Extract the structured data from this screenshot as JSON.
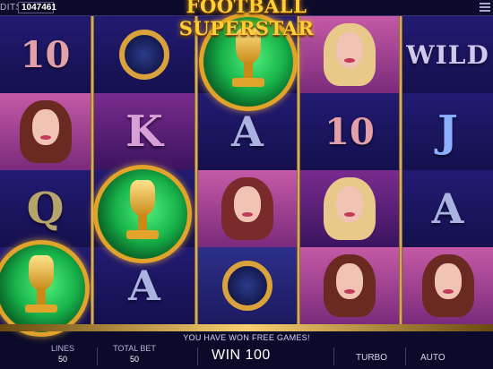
{
  "header": {
    "credits_label": "DITS",
    "credits_value": "1047461",
    "logo": "FOOTBALL SUPERSTAR"
  },
  "reels": [
    {
      "symbols": [
        "10",
        "woman",
        "Q",
        "trophy"
      ]
    },
    {
      "symbols": [
        "watch",
        "K",
        "trophy",
        "A"
      ]
    },
    {
      "symbols": [
        "trophy",
        "A",
        "woman",
        "watch"
      ]
    },
    {
      "symbols": [
        "woman-blonde",
        "10",
        "woman-blonde",
        "woman"
      ]
    },
    {
      "symbols": [
        "WILD",
        "J",
        "A",
        "woman"
      ]
    }
  ],
  "symbols_text": {
    "ten": "10",
    "K": "K",
    "Q": "Q",
    "A": "A",
    "J": "J",
    "wild": "WILD"
  },
  "footer": {
    "message": "YOU HAVE WON FREE GAMES!",
    "lines_label": "LINES",
    "lines_value": "50",
    "total_bet_label": "TOTAL BET",
    "total_bet_value": "50",
    "win_text": "WIN 100",
    "turbo_label": "TURBO",
    "auto_label": "AUTO"
  },
  "colors": {
    "logo_gold": "#ffcf3a",
    "reel_frame_gold": "#f8d070",
    "background_navy": "#1b1660"
  }
}
